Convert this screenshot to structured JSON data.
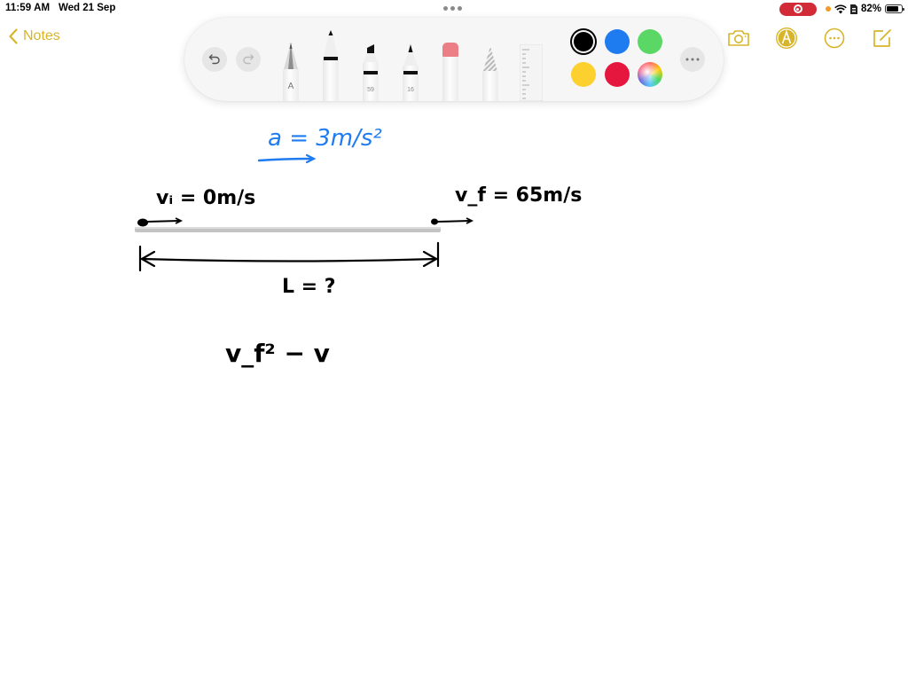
{
  "status_bar": {
    "time": "11:59 AM",
    "date": "Wed 21 Sep",
    "battery_percent": "82%",
    "battery_level": 0.82,
    "icons": [
      "screen-recording-icon",
      "orange-indicator-dot",
      "wifi-icon",
      "sim-icon",
      "battery-icon"
    ]
  },
  "nav": {
    "back_label": "Notes",
    "accent_color": "#d7b52b",
    "right_icons": [
      "camera-icon",
      "markup-icon",
      "more-icon",
      "compose-icon"
    ]
  },
  "palette": {
    "undo_icon": "undo-icon",
    "redo_icon": "redo-icon",
    "tools": [
      {
        "name": "pencil-a",
        "label": "A"
      },
      {
        "name": "pen",
        "label": ""
      },
      {
        "name": "marker",
        "label": "59"
      },
      {
        "name": "fineliner",
        "label": "16"
      },
      {
        "name": "eraser",
        "label": ""
      },
      {
        "name": "lasso",
        "label": ""
      },
      {
        "name": "ruler",
        "label": ""
      }
    ],
    "colors": [
      {
        "name": "black",
        "hex": "#000000",
        "selected": true
      },
      {
        "name": "blue",
        "hex": "#1f7cf0",
        "selected": false
      },
      {
        "name": "green",
        "hex": "#5ad765",
        "selected": false
      },
      {
        "name": "yellow",
        "hex": "#fcd02e",
        "selected": false
      },
      {
        "name": "red",
        "hex": "#e5173f",
        "selected": false
      },
      {
        "name": "multicolor",
        "hex": "conic",
        "selected": false
      }
    ],
    "more_icon": "more-icon"
  },
  "drawing": {
    "acceleration": "a = 3m/s²",
    "initial_velocity": "vᵢ = 0m/s",
    "final_velocity": "v_f = 65m/s",
    "distance": "L = ?",
    "equation_partial": "v_f² − v",
    "ink_blue": "#1f7cf0",
    "ink_black": "#000000"
  }
}
